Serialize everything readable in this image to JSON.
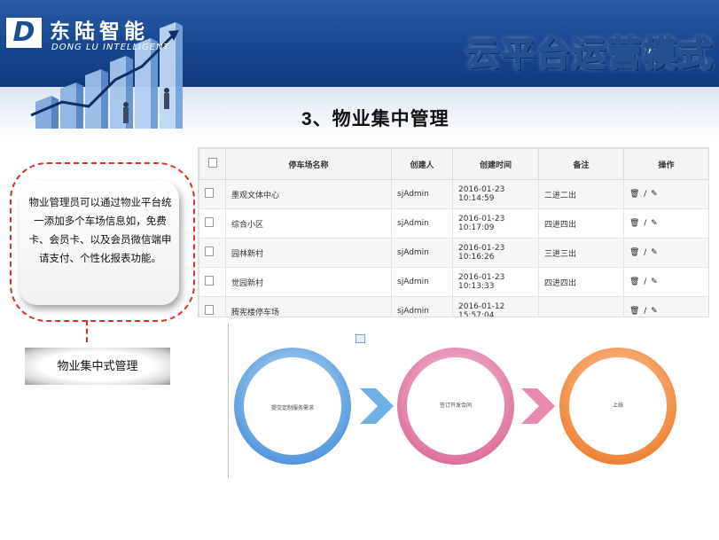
{
  "header": {
    "logo_letter": "D",
    "logo_cn": "东陆智能",
    "logo_en": "DONG LU INTELLIGENT",
    "banner_title": "云平台运营模式"
  },
  "section": {
    "title": "3、物业集中管理"
  },
  "bubble": {
    "text": "物业管理员可以通过物业平台统一添加多个车场信息如，免费卡、会员卡、以及会员微信端申请支付、个性化报表功能。",
    "caption": "物业集中式管理"
  },
  "table": {
    "headers": [
      "停车场名称",
      "创建人",
      "创建时间",
      "备注",
      "操作"
    ],
    "rows": [
      {
        "name": "墨观文体中心",
        "creator": "sjAdmin",
        "time": "2016-01-23 10:14:59",
        "note": "二进二出",
        "ops": "🗑 / ✎"
      },
      {
        "name": "综合小区",
        "creator": "sjAdmin",
        "time": "2016-01-23 10:17:09",
        "note": "四进四出",
        "ops": "🗑 / ✎"
      },
      {
        "name": "园林新村",
        "creator": "sjAdmin",
        "time": "2016-01-23 10:16:26",
        "note": "三进三出",
        "ops": "🗑 / ✎"
      },
      {
        "name": "觉园新村",
        "creator": "sjAdmin",
        "time": "2016-01-23 10:13:33",
        "note": "四进四出",
        "ops": "🗑 / ✎"
      },
      {
        "name": "腾宪楼停车场",
        "creator": "sjAdmin",
        "time": "2016-01-12 15:57:04",
        "note": "",
        "ops": "🗑 / ✎"
      }
    ]
  },
  "process": {
    "steps": [
      {
        "label": "提交定制服务需求",
        "color": "#5b9fe0"
      },
      {
        "label": "签订开发合同",
        "color": "#e17ca4"
      },
      {
        "label": "上线",
        "color": "#ef8a3c"
      }
    ],
    "arrow_colors": [
      "#6fb1e6",
      "#e889ae"
    ]
  }
}
